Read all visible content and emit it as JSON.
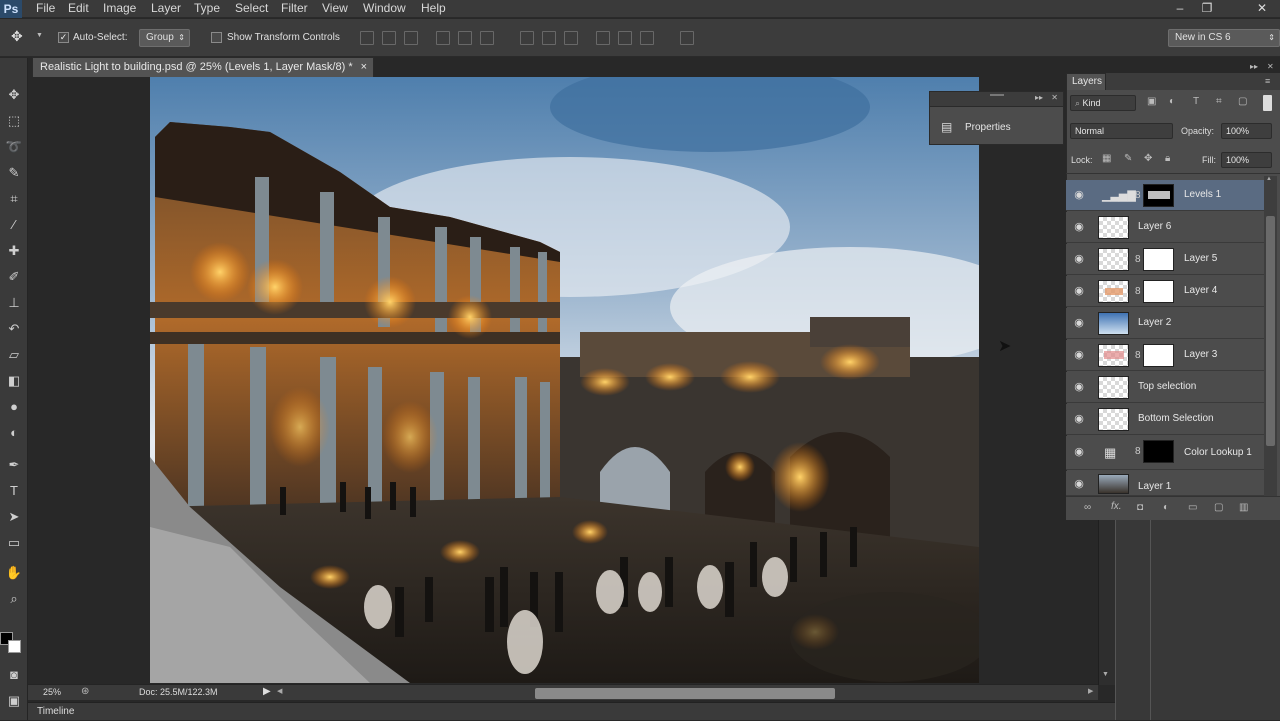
{
  "app": {
    "logo": "Ps"
  },
  "menu": [
    "File",
    "Edit",
    "Image",
    "Layer",
    "Type",
    "Select",
    "Filter",
    "View",
    "Window",
    "Help"
  ],
  "window_controls": {
    "minimize": "–",
    "restore": "❐",
    "close": "✕"
  },
  "options_bar": {
    "auto_select_label": "Auto-Select:",
    "auto_select_checked": true,
    "auto_select_target": "Group",
    "show_transform_label": "Show Transform Controls",
    "workspace": "New in CS 6"
  },
  "document": {
    "tab_title": "Realistic Light to building.psd @ 25% (Levels 1, Layer Mask/8) *",
    "zoom": "25%",
    "doc_info": "Doc: 25.5M/122.3M"
  },
  "timeline_label": "Timeline",
  "properties_panel": {
    "title": "Properties"
  },
  "layers_panel": {
    "tab": "Layers",
    "filter_kind": "Kind",
    "blend_mode": "Normal",
    "opacity_label": "Opacity:",
    "opacity": "100%",
    "lock_label": "Lock:",
    "fill_label": "Fill:",
    "fill": "100%",
    "layers": [
      {
        "name": "Levels 1",
        "selected": true
      },
      {
        "name": "Layer 6",
        "selected": false
      },
      {
        "name": "Layer 5",
        "selected": false
      },
      {
        "name": "Layer 4",
        "selected": false
      },
      {
        "name": "Layer 2",
        "selected": false
      },
      {
        "name": "Layer 3",
        "selected": false
      },
      {
        "name": "Top selection",
        "selected": false
      },
      {
        "name": "Bottom Selection",
        "selected": false
      },
      {
        "name": "Color Lookup 1",
        "selected": false
      },
      {
        "name": "Layer 1",
        "selected": false
      }
    ]
  },
  "colors": {
    "accent_selection": "#5a6b82",
    "panel_bg": "#4c4c4c",
    "app_bg": "#282828"
  }
}
